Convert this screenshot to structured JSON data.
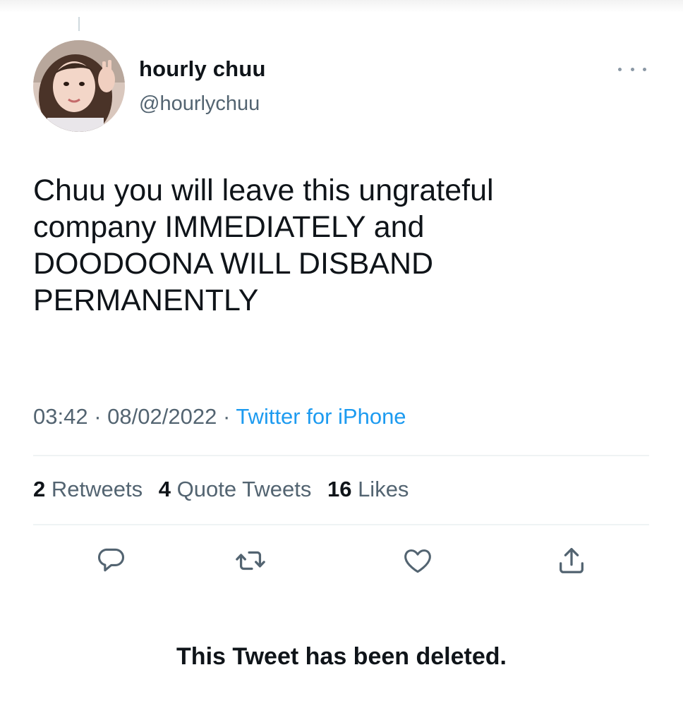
{
  "tweet": {
    "display_name": "hourly chuu",
    "handle": "@hourlychuu",
    "text_lines": [
      "Chuu you will leave this ungrateful",
      "company IMMEDIATELY and",
      "DOODOONA WILL DISBAND",
      "PERMANENTLY"
    ],
    "time": "03:42",
    "date": "08/02/2022",
    "separator": "·",
    "source": "Twitter for iPhone"
  },
  "stats": {
    "retweets_count": "2",
    "retweets_label": "Retweets",
    "quotes_count": "4",
    "quotes_label": "Quote Tweets",
    "likes_count": "16",
    "likes_label": "Likes"
  },
  "actions": {
    "icons": [
      "reply-icon",
      "retweet-icon",
      "like-icon",
      "share-icon"
    ]
  },
  "notice": {
    "deleted_text": "This Tweet has been deleted."
  },
  "colors": {
    "text_primary": "#0f1419",
    "text_secondary": "#536471",
    "link": "#1d9bf0",
    "divider": "#eff3f4",
    "icon": "#536471"
  }
}
